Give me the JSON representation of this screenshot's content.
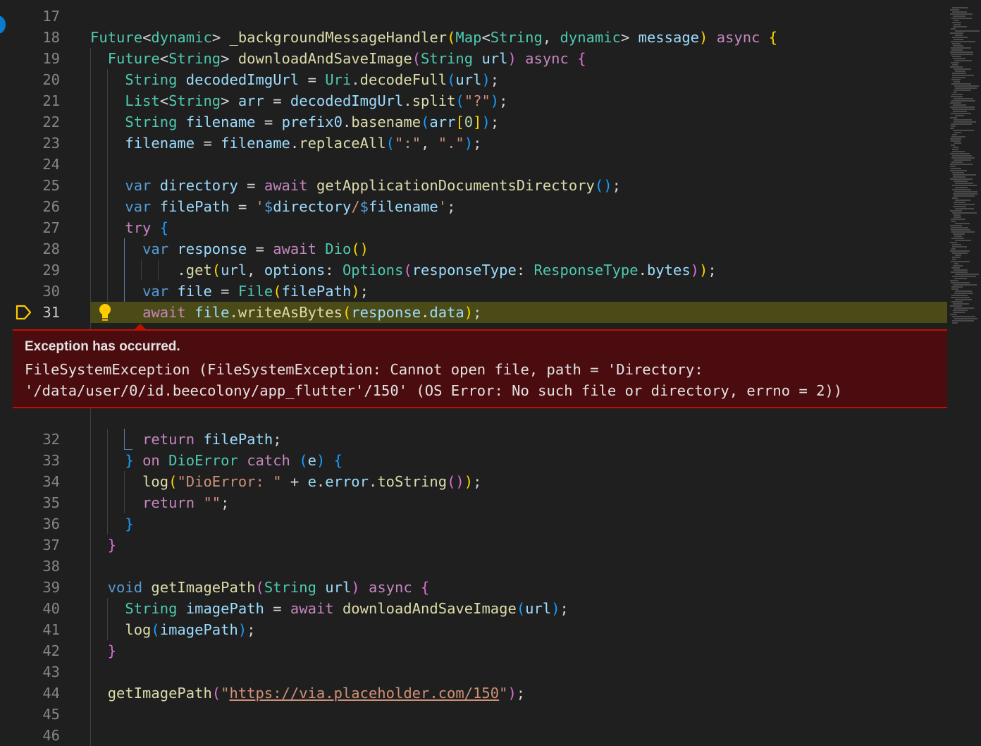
{
  "editor": {
    "lines": [
      {
        "num": "17",
        "text": ""
      },
      {
        "num": "18",
        "text": "Future<dynamic> _backgroundMessageHandler(Map<String, dynamic> message) async {"
      },
      {
        "num": "19",
        "text": "  Future<String> downloadAndSaveImage(String url) async {"
      },
      {
        "num": "20",
        "text": "    String decodedImgUrl = Uri.decodeFull(url);"
      },
      {
        "num": "21",
        "text": "    List<String> arr = decodedImgUrl.split(\"?\");"
      },
      {
        "num": "22",
        "text": "    String filename = prefix0.basename(arr[0]);"
      },
      {
        "num": "23",
        "text": "    filename = filename.replaceAll(\":\", \".\");"
      },
      {
        "num": "24",
        "text": ""
      },
      {
        "num": "25",
        "text": "    var directory = await getApplicationDocumentsDirectory();"
      },
      {
        "num": "26",
        "text": "    var filePath = '$directory/$filename';"
      },
      {
        "num": "27",
        "text": "    try {"
      },
      {
        "num": "28",
        "text": "      var response = await Dio()"
      },
      {
        "num": "29",
        "text": "          .get(url, options: Options(responseType: ResponseType.bytes));"
      },
      {
        "num": "30",
        "text": "      var file = File(filePath);"
      },
      {
        "num": "31",
        "text": "      await file.writeAsBytes(response.data);"
      },
      {
        "num": "32",
        "text": "      return filePath;"
      },
      {
        "num": "33",
        "text": "    } on DioError catch (e) {"
      },
      {
        "num": "34",
        "text": "      log(\"DioError: \" + e.error.toString());"
      },
      {
        "num": "35",
        "text": "      return \"\";"
      },
      {
        "num": "36",
        "text": "    }"
      },
      {
        "num": "37",
        "text": "  }"
      },
      {
        "num": "38",
        "text": ""
      },
      {
        "num": "39",
        "text": "  void getImagePath(String url) async {"
      },
      {
        "num": "40",
        "text": "    String imagePath = await downloadAndSaveImage(url);"
      },
      {
        "num": "41",
        "text": "    log(imagePath);"
      },
      {
        "num": "42",
        "text": "  }"
      },
      {
        "num": "43",
        "text": ""
      },
      {
        "num": "44",
        "text": "  getImagePath(\"https://via.placeholder.com/150\");"
      },
      {
        "num": "45",
        "text": ""
      },
      {
        "num": "46",
        "text": ""
      }
    ]
  },
  "exception": {
    "title": "Exception has occurred.",
    "message_line1": "FileSystemException (FileSystemException: Cannot open file, path = 'Directory:",
    "message_line2": "'/data/user/0/id.beecolony/app_flutter'/150' (OS Error: No such file or directory, errno = 2))"
  },
  "colors": {
    "background": "#1f1f1f",
    "current_line_highlight": "#4b4b18",
    "exception_background": "#4a0c0f",
    "exception_border": "#be1100"
  }
}
